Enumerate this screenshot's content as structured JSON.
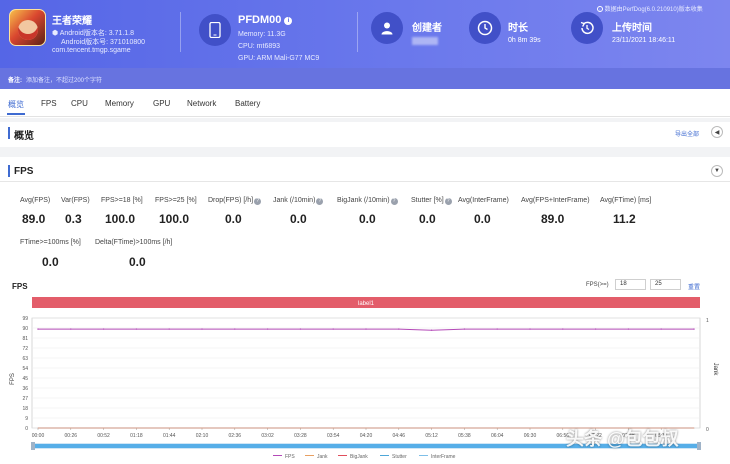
{
  "app": {
    "name": "王者荣耀",
    "android_version": "Android版本名: 3.71.1.8",
    "android_code": "Android版本号: 371010800",
    "package": "com.tencent.tmgp.sgame"
  },
  "device": {
    "name": "PFDM00",
    "badge": "i",
    "memory": "Memory: 11.3G",
    "cpu": "CPU: mt6893",
    "gpu": "GPU: ARM Mali-G77 MC9"
  },
  "creator": {
    "label": "创建者"
  },
  "duration": {
    "label": "时长",
    "value": "0h 8m 39s"
  },
  "upload": {
    "label": "上传时间",
    "value": "23/11/2021 18:46:11"
  },
  "data_source": "数据由PerfDog(6.0.210910)版本收集",
  "note": {
    "label": "备注:",
    "placeholder": "添加备注，不超过200个字符"
  },
  "tabs": [
    "概览",
    "FPS",
    "CPU",
    "Memory",
    "GPU",
    "Network",
    "Battery"
  ],
  "overview": {
    "title": "概览",
    "export": "导出全部"
  },
  "fps_section": {
    "title": "FPS",
    "stats_row1": [
      {
        "label": "Avg(FPS)",
        "value": "89.0"
      },
      {
        "label": "Var(FPS)",
        "value": "0.3"
      },
      {
        "label": "FPS>=18 [%]",
        "value": "100.0"
      },
      {
        "label": "FPS>=25 [%]",
        "value": "100.0"
      },
      {
        "label": "Drop(FPS) [/h]",
        "value": "0.0"
      },
      {
        "label": "Jank (/10min)",
        "value": "0.0"
      },
      {
        "label": "BigJank (/10min)",
        "value": "0.0"
      },
      {
        "label": "Stutter [%]",
        "value": "0.0"
      },
      {
        "label": "Avg(InterFrame)",
        "value": "0.0"
      },
      {
        "label": "Avg(FPS+InterFrame)",
        "value": "89.0"
      },
      {
        "label": "Avg(FTime) [ms]",
        "value": "11.2"
      }
    ],
    "stats_row2": [
      {
        "label": "FTime>=100ms [%]",
        "value": "0.0"
      },
      {
        "label": "Delta(FTime)>100ms [/h]",
        "value": "0.0"
      }
    ]
  },
  "chart": {
    "title": "FPS",
    "threshold_label": "FPS(>=)",
    "threshold_1": "18",
    "threshold_2": "25",
    "reset": "重置",
    "band_label": "label1",
    "y_axis_label": "FPS",
    "y2_axis_label": "Jank",
    "y2_ticks": [
      "1",
      "0"
    ],
    "watermark": "头条 @包包叔"
  },
  "chart_data": {
    "type": "line",
    "title": "FPS",
    "xlabel": "",
    "ylabel": "FPS",
    "ylim": [
      0,
      99
    ],
    "yticks": [
      99,
      90,
      81,
      72,
      63,
      54,
      45,
      36,
      27,
      18,
      9,
      0
    ],
    "xticks": [
      "00:00",
      "00:26",
      "00:52",
      "01:18",
      "01:44",
      "02:10",
      "02:36",
      "03:02",
      "03:28",
      "03:54",
      "04:20",
      "04:46",
      "05:12",
      "05:38",
      "06:04",
      "06:30",
      "06:56",
      "07:22",
      "07:48",
      "08:14"
    ],
    "x": [
      "00:00",
      "00:26",
      "00:52",
      "01:18",
      "01:44",
      "02:10",
      "02:36",
      "03:02",
      "03:28",
      "03:54",
      "04:20",
      "04:46",
      "05:12",
      "05:38",
      "06:04",
      "06:30",
      "06:56",
      "07:22",
      "07:48",
      "08:14",
      "08:39"
    ],
    "series": [
      {
        "name": "FPS",
        "color": "#b44ab8",
        "values": [
          89,
          89,
          89,
          89,
          89,
          89,
          89,
          89,
          89,
          89,
          89,
          89,
          88,
          89,
          89,
          89,
          89,
          89,
          89,
          89,
          89
        ]
      },
      {
        "name": "Jank",
        "color": "#e8a062",
        "values": [
          0,
          0,
          0,
          0,
          0,
          0,
          0,
          0,
          0,
          0,
          0,
          0,
          0,
          0,
          0,
          0,
          0,
          0,
          0,
          0,
          0
        ]
      },
      {
        "name": "BigJank",
        "color": "#e04e5c",
        "values": [
          0,
          0,
          0,
          0,
          0,
          0,
          0,
          0,
          0,
          0,
          0,
          0,
          0,
          0,
          0,
          0,
          0,
          0,
          0,
          0,
          0
        ]
      },
      {
        "name": "Stutter",
        "color": "#4ea7d8",
        "values": [
          0,
          0,
          0,
          0,
          0,
          0,
          0,
          0,
          0,
          0,
          0,
          0,
          0,
          0,
          0,
          0,
          0,
          0,
          0,
          0,
          0
        ]
      },
      {
        "name": "InterFrame",
        "color": "#7fbfe8",
        "values": [
          0,
          0,
          0,
          0,
          0,
          0,
          0,
          0,
          0,
          0,
          0,
          0,
          0,
          0,
          0,
          0,
          0,
          0,
          0,
          0,
          0
        ]
      }
    ],
    "legend": "bottom",
    "grid": true
  },
  "colors": {
    "header": "#5566e6",
    "accent": "#3f6bd1",
    "band": "#e35d6a",
    "fps_line": "#b44ab8"
  },
  "icons": {
    "device": "phone-icon",
    "creator": "user-icon",
    "duration": "clock-icon",
    "upload": "history-icon",
    "source": "info-icon"
  }
}
